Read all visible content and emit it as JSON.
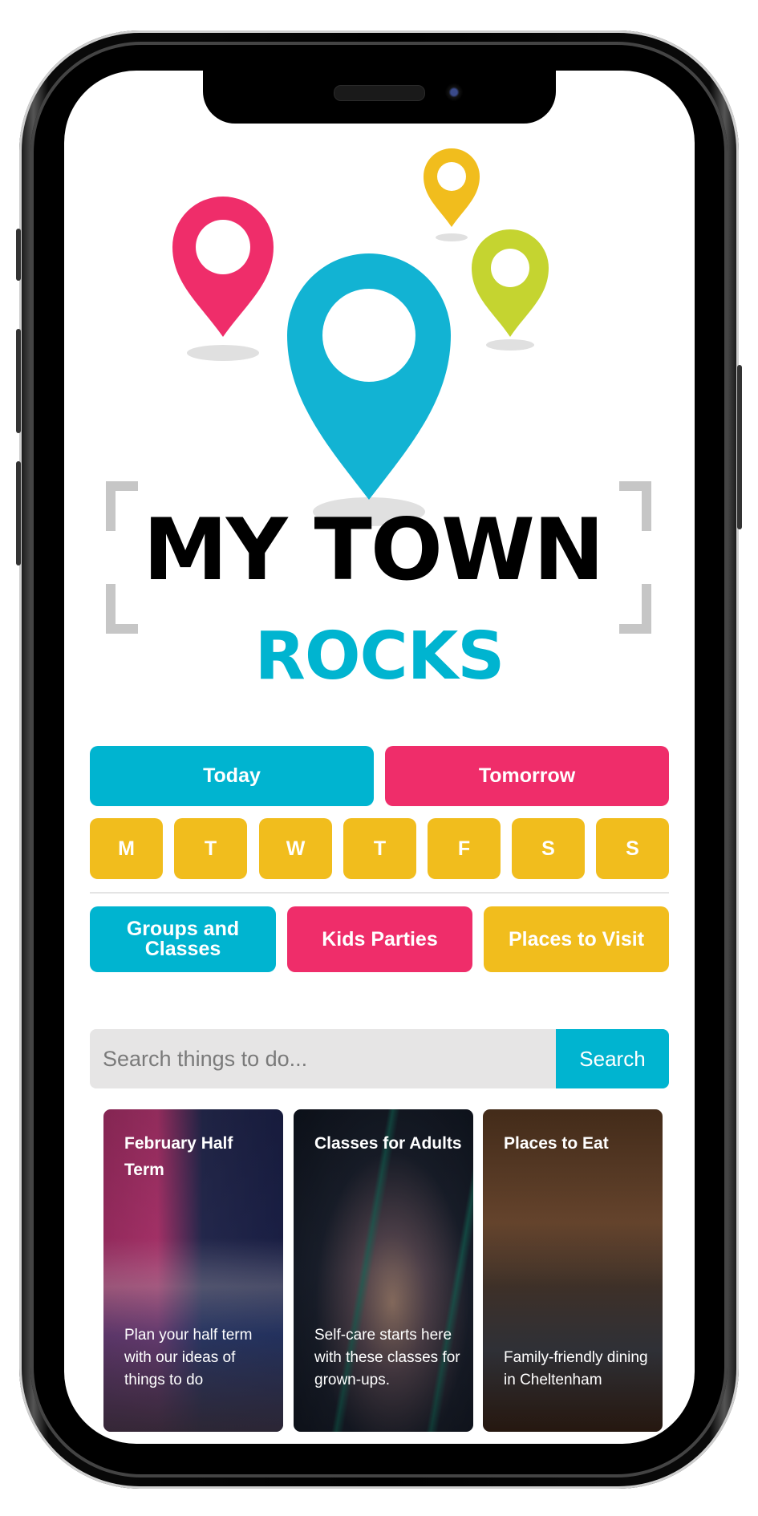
{
  "app": {
    "name_line1": "MY TOWN",
    "name_line2": "ROCKS"
  },
  "colors": {
    "cyan": "#00b4d0",
    "pink": "#ef2d6a",
    "yellow": "#f1bd1d",
    "lime": "#c5d430"
  },
  "quick_dates": [
    {
      "label": "Today"
    },
    {
      "label": "Tomorrow"
    }
  ],
  "weekdays": [
    {
      "label": "M"
    },
    {
      "label": "T"
    },
    {
      "label": "W"
    },
    {
      "label": "T"
    },
    {
      "label": "F"
    },
    {
      "label": "S"
    },
    {
      "label": "S"
    }
  ],
  "categories": [
    {
      "label": "Groups and Classes"
    },
    {
      "label": "Kids Parties"
    },
    {
      "label": "Places to Visit"
    }
  ],
  "search": {
    "placeholder": "Search things to do...",
    "value": "",
    "button_label": "Search"
  },
  "cards": [
    {
      "title": "February Half Term",
      "description": "Plan your half term with our ideas of things to do"
    },
    {
      "title": "Classes for Adults",
      "description": "Self-care starts here with these classes for grown-ups."
    },
    {
      "title": "Places to Eat",
      "description": "Family-friendly dining in Cheltenham"
    }
  ]
}
